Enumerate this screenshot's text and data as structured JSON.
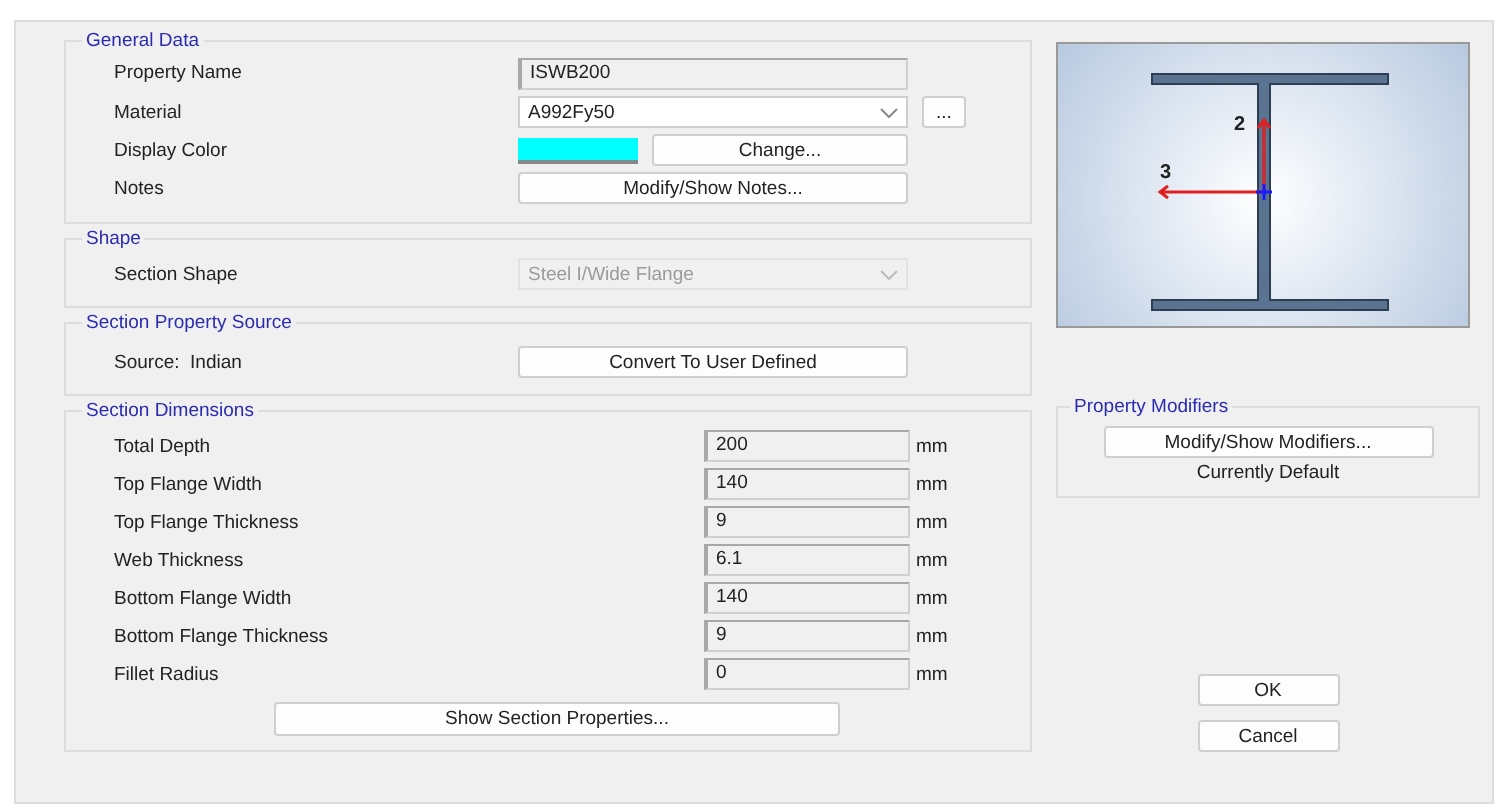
{
  "general_data": {
    "title": "General Data",
    "fields": [
      {
        "label": "Property Name",
        "kind": "text",
        "value": "ISWB200"
      },
      {
        "label": "Material",
        "kind": "dropdown",
        "value": "A992Fy50",
        "extra_button": "..."
      },
      {
        "label": "Display Color",
        "kind": "color",
        "color": "#00ffff",
        "button": "Change..."
      },
      {
        "label": "Notes",
        "kind": "button",
        "button": "Modify/Show Notes..."
      }
    ]
  },
  "shape": {
    "title": "Shape",
    "label": "Section Shape",
    "value": "Steel I/Wide Flange",
    "disabled": true
  },
  "section_property_source": {
    "title": "Section Property Source",
    "label": "Source:  Indian",
    "button": "Convert To User Defined"
  },
  "section_dimensions": {
    "title": "Section Dimensions",
    "rows": [
      {
        "label": "Total Depth",
        "value": "200",
        "unit": "mm"
      },
      {
        "label": "Top Flange Width",
        "value": "140",
        "unit": "mm"
      },
      {
        "label": "Top Flange Thickness",
        "value": "9",
        "unit": "mm"
      },
      {
        "label": "Web Thickness",
        "value": "6.1",
        "unit": "mm"
      },
      {
        "label": "Bottom Flange Width",
        "value": "140",
        "unit": "mm"
      },
      {
        "label": "Bottom Flange Thickness",
        "value": "9",
        "unit": "mm"
      },
      {
        "label": "Fillet Radius",
        "value": "0",
        "unit": "mm"
      }
    ],
    "button": "Show Section Properties..."
  },
  "preview": {
    "axis_vertical": "2",
    "axis_horizontal": "3"
  },
  "property_modifiers": {
    "title": "Property Modifiers",
    "button": "Modify/Show Modifiers...",
    "status": "Currently Default"
  },
  "buttons": [
    "OK",
    "Cancel"
  ]
}
